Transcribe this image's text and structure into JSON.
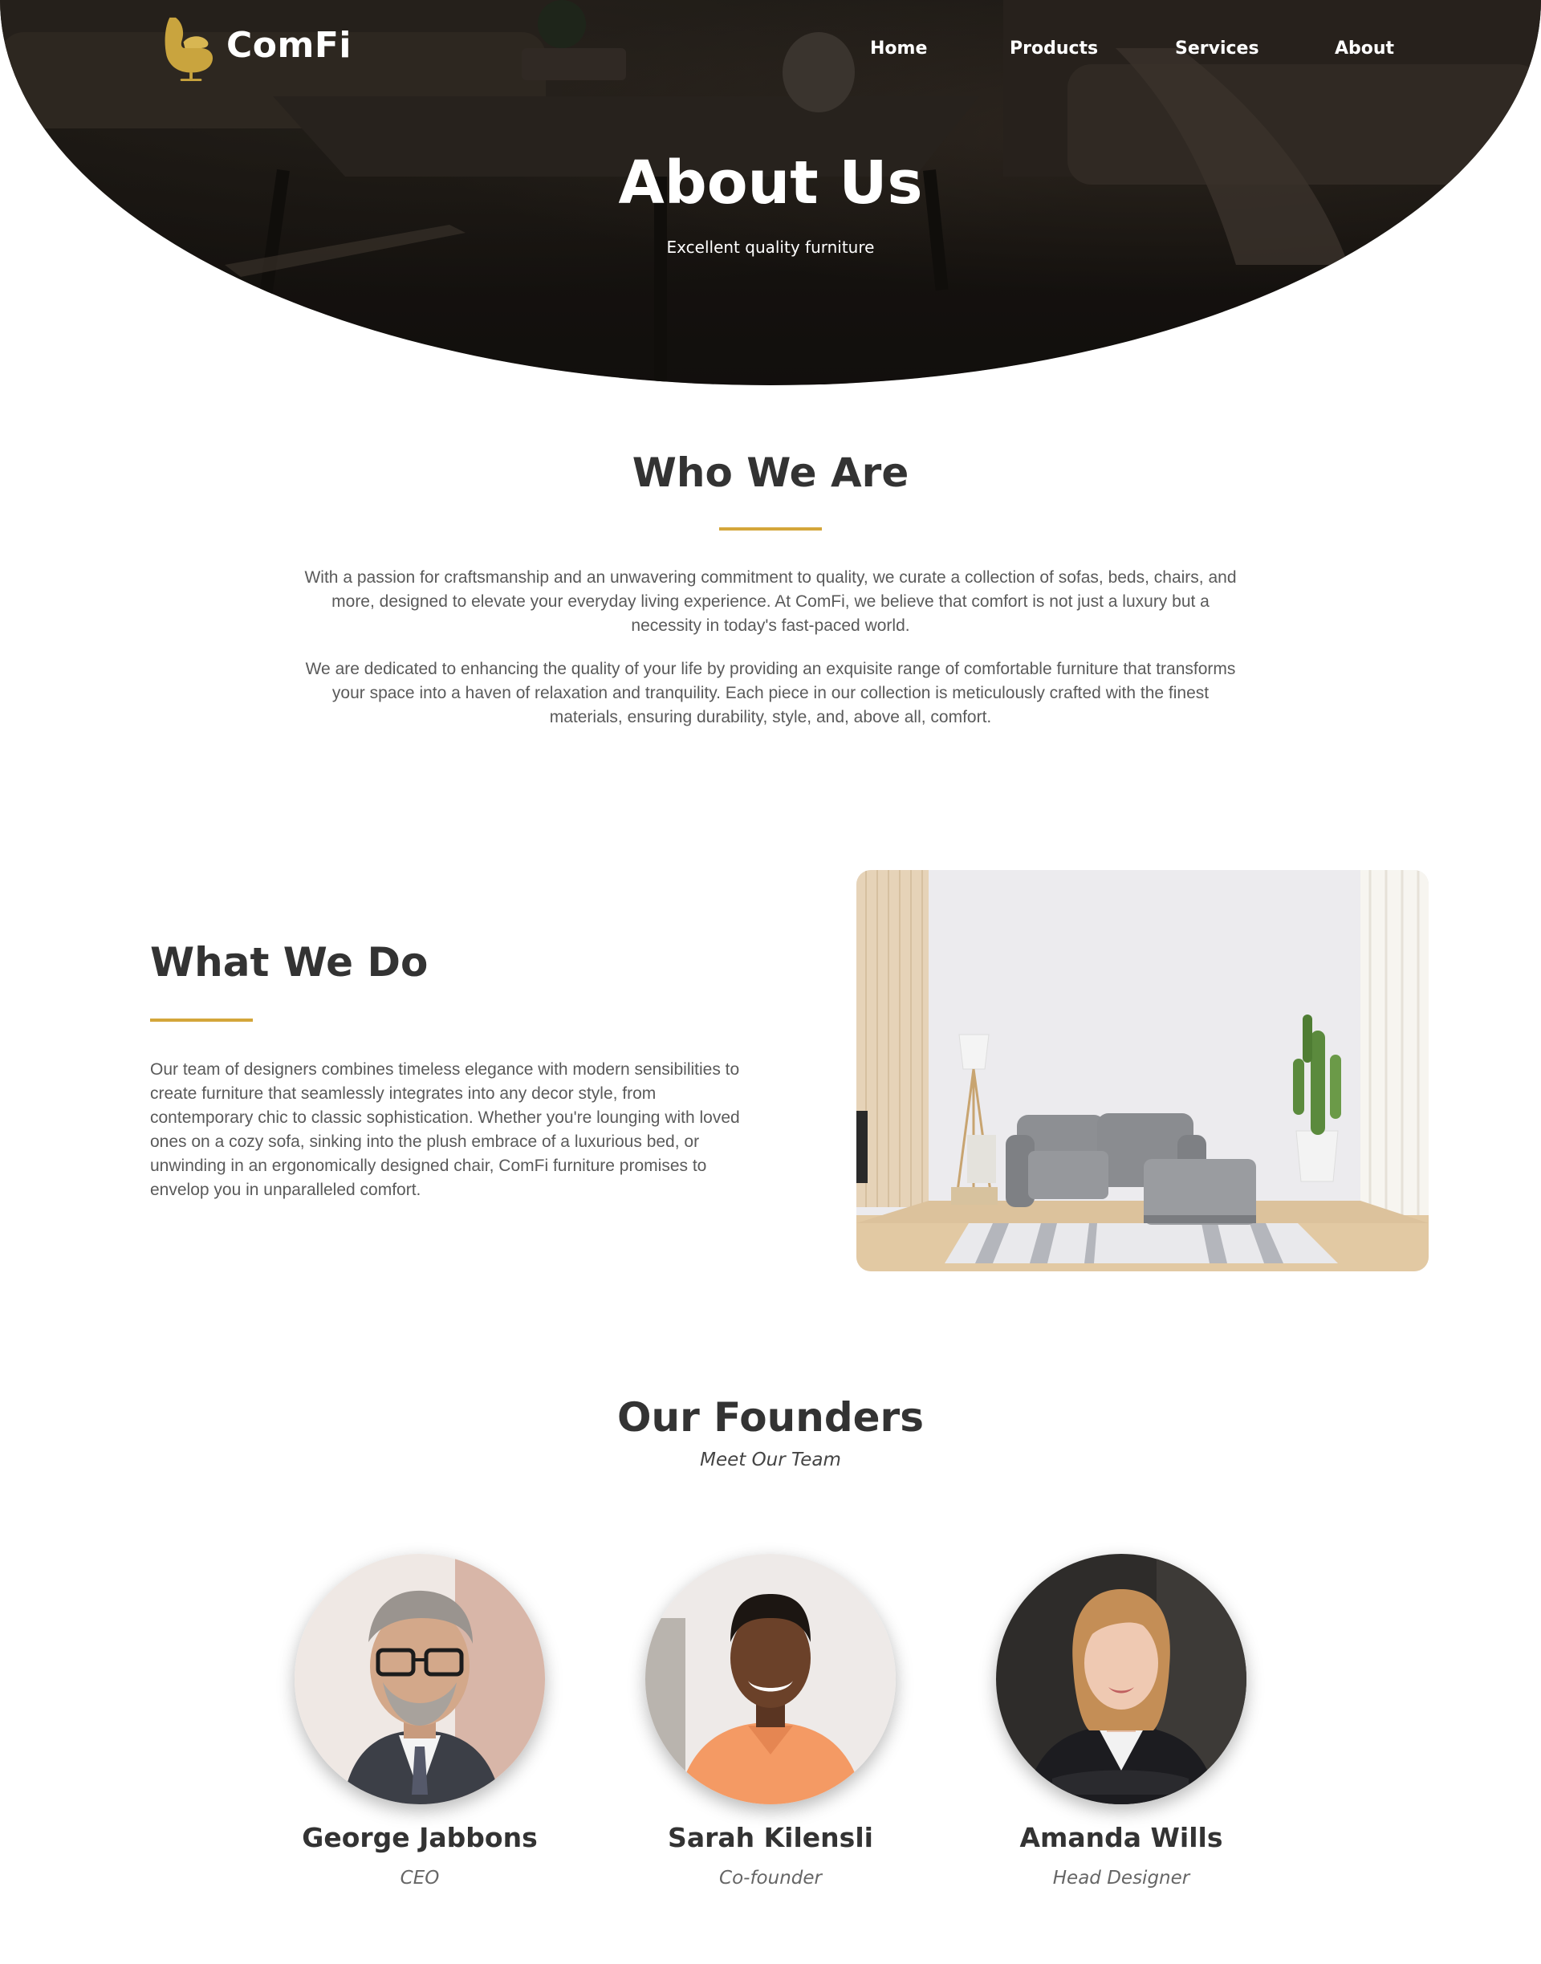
{
  "brand": {
    "name": "ComFi",
    "accent": "#d4a63a"
  },
  "nav": {
    "items": [
      "Home",
      "Products",
      "Services",
      "About"
    ]
  },
  "hero": {
    "title": "About Us",
    "subtitle": "Excellent quality furniture"
  },
  "who": {
    "title": "Who We Are",
    "paragraphs": [
      "With a passion for craftsmanship and an unwavering commitment to quality, we curate a collection of sofas, beds, chairs, and more, designed to elevate your everyday living experience. At ComFi, we believe that comfort is not just a luxury but a necessity in today's fast-paced world.",
      "We are dedicated to enhancing the quality of your life by providing an exquisite range of comfortable furniture that transforms your space into a haven of relaxation and tranquility. Each piece in our collection is meticulously crafted with the finest materials, ensuring durability, style, and, above all, comfort."
    ]
  },
  "what": {
    "title": "What We Do",
    "text": "Our team of designers combines timeless elegance with modern sensibilities to create furniture that seamlessly integrates into any decor style, from contemporary chic to classic sophistication. Whether you're lounging with loved ones on a cozy sofa, sinking into the plush embrace of a luxurious bed, or unwinding in an ergonomically designed chair, ComFi furniture promises to envelop you in unparalleled comfort."
  },
  "founders": {
    "title": "Our Founders",
    "subtitle": "Meet Our Team",
    "people": [
      {
        "name": "George Jabbons",
        "role": "CEO"
      },
      {
        "name": "Sarah Kilensli",
        "role": "Co-founder"
      },
      {
        "name": "Amanda Wills",
        "role": "Head Designer"
      }
    ]
  }
}
